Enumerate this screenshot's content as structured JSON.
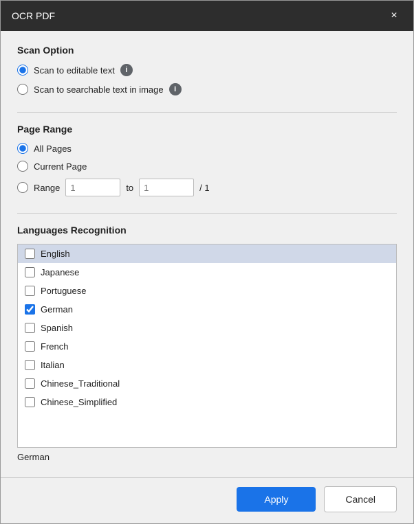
{
  "dialog": {
    "title": "OCR PDF",
    "close_label": "×"
  },
  "scan_option": {
    "section_title": "Scan Option",
    "options": [
      {
        "id": "editable",
        "label": "Scan to editable text",
        "checked": true,
        "has_info": true
      },
      {
        "id": "searchable",
        "label": "Scan to searchable text in image",
        "checked": false,
        "has_info": true
      }
    ]
  },
  "page_range": {
    "section_title": "Page Range",
    "options": [
      {
        "id": "all",
        "label": "All Pages",
        "checked": true
      },
      {
        "id": "current",
        "label": "Current Page",
        "checked": false
      },
      {
        "id": "range",
        "label": "Range",
        "checked": false
      }
    ],
    "range_from_placeholder": "1",
    "range_to_placeholder": "1",
    "range_to_label": "to",
    "range_total": "/ 1"
  },
  "languages": {
    "section_title": "Languages Recognition",
    "items": [
      {
        "label": "English",
        "checked": false,
        "highlighted": true
      },
      {
        "label": "Japanese",
        "checked": false,
        "highlighted": false
      },
      {
        "label": "Portuguese",
        "checked": false,
        "highlighted": false
      },
      {
        "label": "German",
        "checked": true,
        "highlighted": false
      },
      {
        "label": "Spanish",
        "checked": false,
        "highlighted": false
      },
      {
        "label": "French",
        "checked": false,
        "highlighted": false
      },
      {
        "label": "Italian",
        "checked": false,
        "highlighted": false
      },
      {
        "label": "Chinese_Traditional",
        "checked": false,
        "highlighted": false
      },
      {
        "label": "Chinese_Simplified",
        "checked": false,
        "highlighted": false
      }
    ],
    "selected_display": "German"
  },
  "footer": {
    "apply_label": "Apply",
    "cancel_label": "Cancel"
  }
}
